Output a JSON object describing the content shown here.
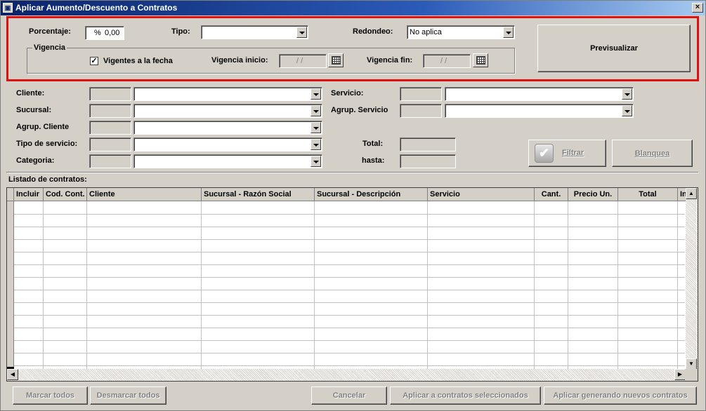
{
  "window": {
    "title": "Aplicar Aumento/Descuento a Contratos",
    "close": "×"
  },
  "top": {
    "porcentaje_label": "Porcentaje:",
    "porcentaje_symbol": "%",
    "porcentaje_value": "0,00",
    "tipo_label": "Tipo:",
    "tipo_value": "",
    "redondeo_label": "Redondeo:",
    "redondeo_value": "No aplica",
    "vigencia_group": "Vigencia",
    "vigentes_label": "Vigentes a la fecha",
    "vigentes_checked": "✓",
    "vigencia_inicio_label": "Vigencia inicio:",
    "vigencia_inicio_value": "/ /",
    "vigencia_fin_label": "Vigencia fin:",
    "vigencia_fin_value": "/ /",
    "previsualizar": "Previsualizar"
  },
  "filters": {
    "cliente": "Cliente:",
    "sucursal": "Sucursal:",
    "agrup_cliente": "Agrup. Cliente",
    "tipo_servicio": "Tipo de servicio:",
    "categoria": "Categoria:",
    "servicio": "Servicio:",
    "agrup_servicio": "Agrup. Servicio",
    "total": "Total:",
    "hasta": "hasta:",
    "filtrar": "Filtrar",
    "blanquea": "Blanquea"
  },
  "listado": {
    "title": "Listado de contratos:",
    "columns": [
      "Incluir",
      "Cod. Cont.",
      "Cliente",
      "Sucursal - Razón Social",
      "Sucursal - Descripción",
      "Servicio",
      "Cant.",
      "Precio Un.",
      "Total",
      "Ini"
    ]
  },
  "bottom": {
    "marcar_todos": "Marcar todos",
    "desmarcar_todos": "Desmarcar todos",
    "cancelar": "Cancelar",
    "aplicar_seleccionados": "Aplicar a contratos seleccionados",
    "aplicar_nuevos": "Aplicar generando nuevos contratos"
  },
  "colors": {
    "highlight": "#e01010",
    "titlebar": "#0a246a",
    "face": "#d4d0c8"
  }
}
